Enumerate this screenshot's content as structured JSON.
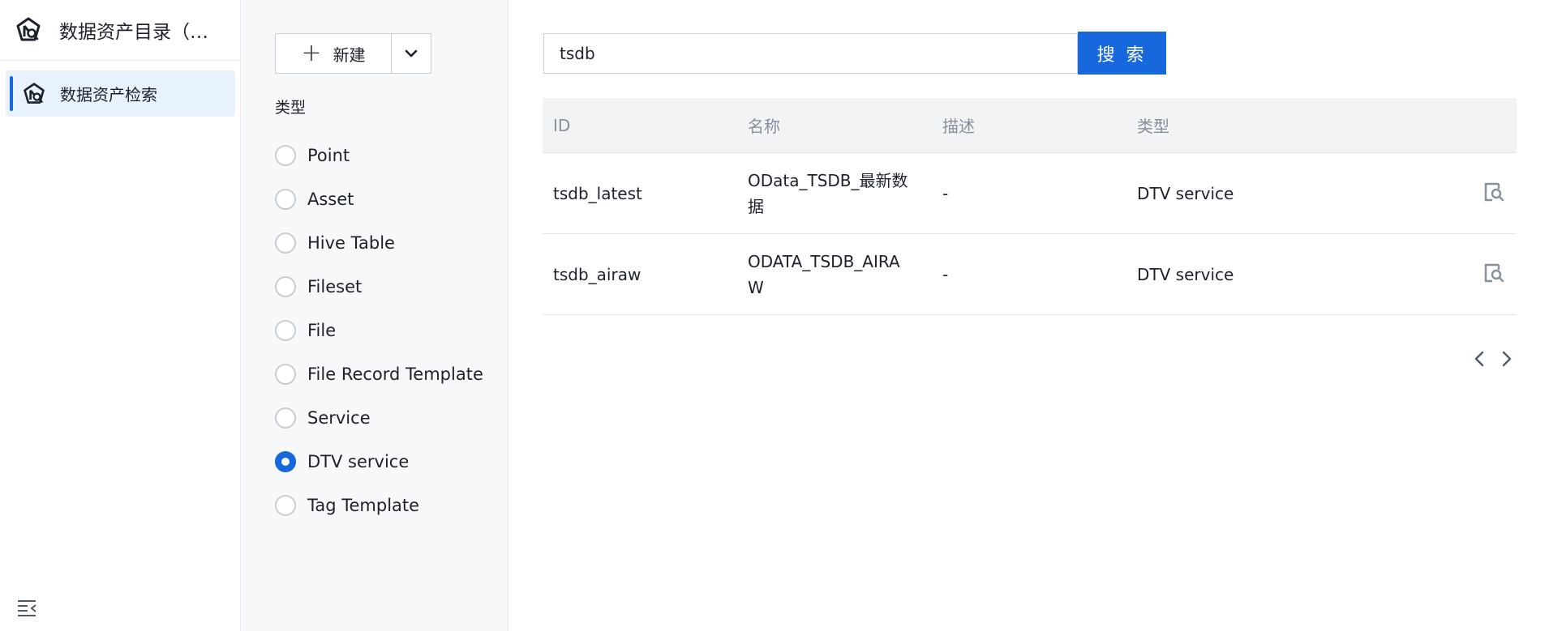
{
  "app": {
    "title": "数据资产目录（…",
    "logo_icon": "asset-catalog-logo-icon"
  },
  "sidebar": {
    "items": [
      {
        "label": "数据资产检索",
        "icon": "asset-search-icon",
        "active": true
      }
    ],
    "collapse_icon": "collapse-menu-icon"
  },
  "filter": {
    "new_button_label": "新建",
    "new_dropdown_icon": "chevron-down-icon",
    "type_title": "类型",
    "types": [
      {
        "label": "Point",
        "checked": false
      },
      {
        "label": "Asset",
        "checked": false
      },
      {
        "label": "Hive Table",
        "checked": false
      },
      {
        "label": "Fileset",
        "checked": false
      },
      {
        "label": "File",
        "checked": false
      },
      {
        "label": "File Record Template",
        "checked": false
      },
      {
        "label": "Service",
        "checked": false
      },
      {
        "label": "DTV service",
        "checked": true
      },
      {
        "label": "Tag Template",
        "checked": false
      }
    ]
  },
  "search": {
    "value": "tsdb",
    "button_label": "搜 索"
  },
  "table": {
    "columns": [
      "ID",
      "名称",
      "描述",
      "类型"
    ],
    "rows": [
      {
        "id": "tsdb_latest",
        "name": "OData_TSDB_最新数据",
        "desc": "-",
        "type": "DTV service",
        "action_icon": "view-detail-icon"
      },
      {
        "id": "tsdb_airaw",
        "name": "ODATA_TSDB_AIRAW",
        "desc": "-",
        "type": "DTV service",
        "action_icon": "view-detail-icon"
      }
    ]
  },
  "pagination": {
    "prev_icon": "chevron-left-icon",
    "next_icon": "chevron-right-icon"
  },
  "colors": {
    "primary": "#1668dc",
    "active_bg": "#e8f2ff",
    "panel_bg": "#f7f8fa",
    "header_bg": "#f2f3f5",
    "muted_text": "#86909c"
  }
}
